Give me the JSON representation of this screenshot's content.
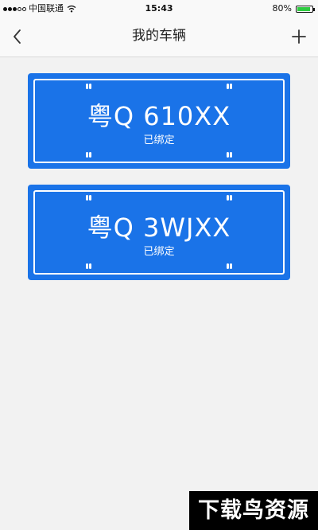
{
  "status_bar": {
    "carrier": "中国联通",
    "time": "15:43",
    "battery": "80%",
    "battery_level": 0.8,
    "signal_bars_filled": 3,
    "signal_bars_total": 5
  },
  "nav": {
    "title": "我的车辆",
    "back_icon": "chevron-left-icon",
    "add_icon": "plus-icon"
  },
  "vehicles": [
    {
      "plate": "粤Q 610XX",
      "status": "已绑定"
    },
    {
      "plate": "粤Q 3WJXX",
      "status": "已绑定"
    }
  ],
  "colors": {
    "plate_blue": "#1a73e8",
    "background": "#f2f2f2"
  },
  "watermark": "下载鸟资源"
}
